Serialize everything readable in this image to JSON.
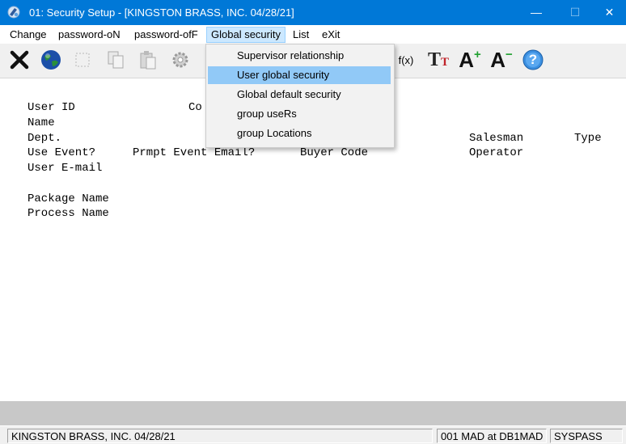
{
  "window": {
    "title": "01: Security Setup - [KINGSTON BRASS, INC. 04/28/21]",
    "min_glyph": "—",
    "max_glyph": "☐",
    "close_glyph": "✕"
  },
  "menu": {
    "items": [
      {
        "label": "Change"
      },
      {
        "label": "password-oN"
      },
      {
        "label": "password-ofF"
      },
      {
        "label": "Global security"
      },
      {
        "label": "List"
      },
      {
        "label": "eXit"
      }
    ]
  },
  "dropdown": {
    "items": [
      {
        "label": "Supervisor relationship"
      },
      {
        "label": "User global security"
      },
      {
        "label": "Global default security"
      },
      {
        "label": "group useRs"
      },
      {
        "label": "group Locations"
      }
    ],
    "highlighted_index": 1
  },
  "toolbar": {
    "function_label": "f(x)",
    "font_label_large": "T",
    "font_label_small": "T",
    "grow_label": "A",
    "shrink_label": "A",
    "plus": "+",
    "minus": "−",
    "help_label": "?"
  },
  "form": {
    "labels": {
      "user_id": "User ID",
      "co_partial": "Co",
      "name": "Name",
      "dept": "Dept.",
      "salesman": "Salesman",
      "type": "Type",
      "use_event": "Use Event?",
      "prompt_event_email": "Prmpt Event Email?",
      "buyer_code": "Buyer Code",
      "operator": "Operator",
      "user_email": "User E-mail",
      "package_name": "Package Name",
      "process_name": "Process Name"
    }
  },
  "status": {
    "company": "KINGSTON BRASS, INC. 04/28/21",
    "location": "001 MAD at DB1MAD",
    "user": "SYSPASS"
  },
  "colors": {
    "titlebar": "#0078d7",
    "menu_active": "#cce8ff",
    "dropdown_highlight": "#91c9f7"
  }
}
